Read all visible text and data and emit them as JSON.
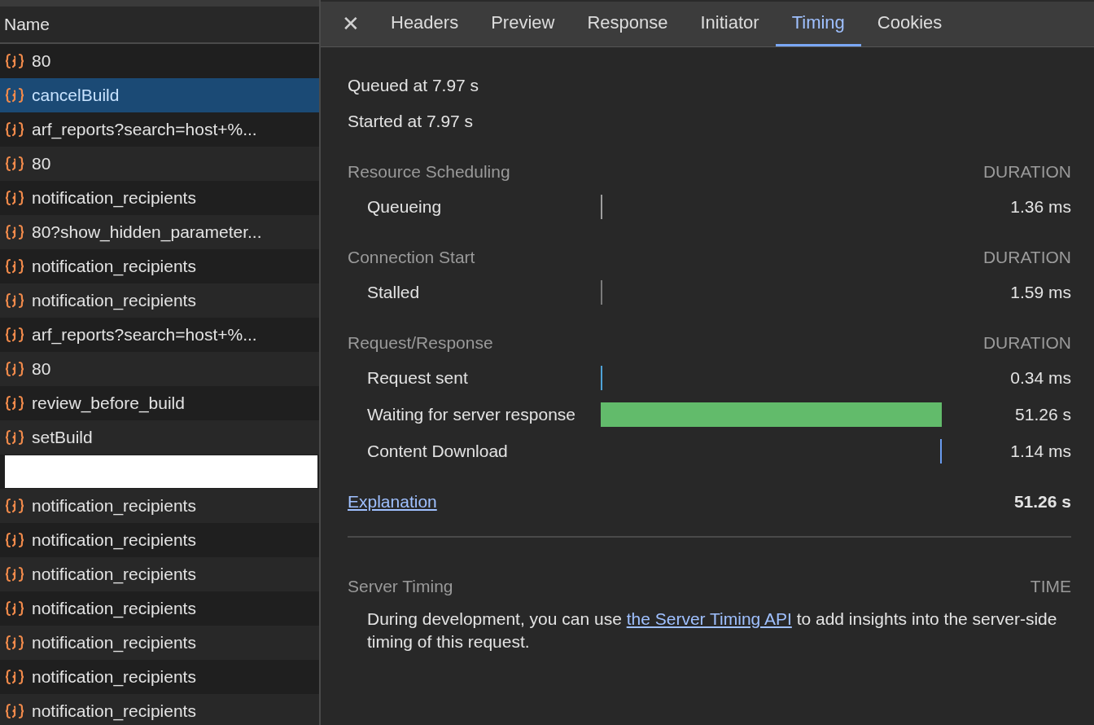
{
  "requests": {
    "header": "Name",
    "rows": [
      {
        "kind": "request",
        "name": "80",
        "selected": false
      },
      {
        "kind": "request",
        "name": "cancelBuild",
        "selected": true
      },
      {
        "kind": "request",
        "name": "arf_reports?search=host+%...",
        "selected": false
      },
      {
        "kind": "request",
        "name": "80",
        "selected": false
      },
      {
        "kind": "request",
        "name": "notification_recipients",
        "selected": false
      },
      {
        "kind": "request",
        "name": "80?show_hidden_parameter...",
        "selected": false
      },
      {
        "kind": "request",
        "name": "notification_recipients",
        "selected": false
      },
      {
        "kind": "request",
        "name": "notification_recipients",
        "selected": false
      },
      {
        "kind": "request",
        "name": "arf_reports?search=host+%...",
        "selected": false
      },
      {
        "kind": "request",
        "name": "80",
        "selected": false
      },
      {
        "kind": "request",
        "name": "review_before_build",
        "selected": false
      },
      {
        "kind": "request",
        "name": "setBuild",
        "selected": false
      },
      {
        "kind": "redacted"
      },
      {
        "kind": "request",
        "name": "notification_recipients",
        "selected": false
      },
      {
        "kind": "request",
        "name": "notification_recipients",
        "selected": false
      },
      {
        "kind": "request",
        "name": "notification_recipients",
        "selected": false
      },
      {
        "kind": "request",
        "name": "notification_recipients",
        "selected": false
      },
      {
        "kind": "request",
        "name": "notification_recipients",
        "selected": false
      },
      {
        "kind": "request",
        "name": "notification_recipients",
        "selected": false
      },
      {
        "kind": "request",
        "name": "notification_recipients",
        "selected": false
      }
    ]
  },
  "close_button": "✕",
  "tabs": [
    {
      "label": "Headers",
      "selected": false
    },
    {
      "label": "Preview",
      "selected": false
    },
    {
      "label": "Response",
      "selected": false
    },
    {
      "label": "Initiator",
      "selected": false
    },
    {
      "label": "Timing",
      "selected": true
    },
    {
      "label": "Cookies",
      "selected": false
    }
  ],
  "timing": {
    "queued": "Queued at 7.97 s",
    "started": "Started at 7.97 s",
    "sections": [
      {
        "title": "Resource Scheduling",
        "column": "DURATION",
        "phases": [
          {
            "label": "Queueing",
            "value": "1.36 ms",
            "color": "#9e9e9e",
            "kind": "start"
          }
        ]
      },
      {
        "title": "Connection Start",
        "column": "DURATION",
        "phases": [
          {
            "label": "Stalled",
            "value": "1.59 ms",
            "color": "#7a7a7a",
            "kind": "start"
          }
        ]
      },
      {
        "title": "Request/Response",
        "column": "DURATION",
        "phases": [
          {
            "label": "Request sent",
            "value": "0.34 ms",
            "color": "#4fa3d8",
            "kind": "start"
          },
          {
            "label": "Waiting for server response",
            "value": "51.26 s",
            "color": "#62bb6b",
            "kind": "full"
          },
          {
            "label": "Content Download",
            "value": "1.14 ms",
            "color": "#6a9cf0",
            "kind": "end"
          }
        ]
      }
    ],
    "explanation": "Explanation",
    "total": "51.26 s",
    "server_timing": {
      "title": "Server Timing",
      "column": "TIME",
      "text_before": "During development, you can use ",
      "link": "the Server Timing API",
      "text_after": " to add insights into the server-side timing of this request."
    }
  }
}
